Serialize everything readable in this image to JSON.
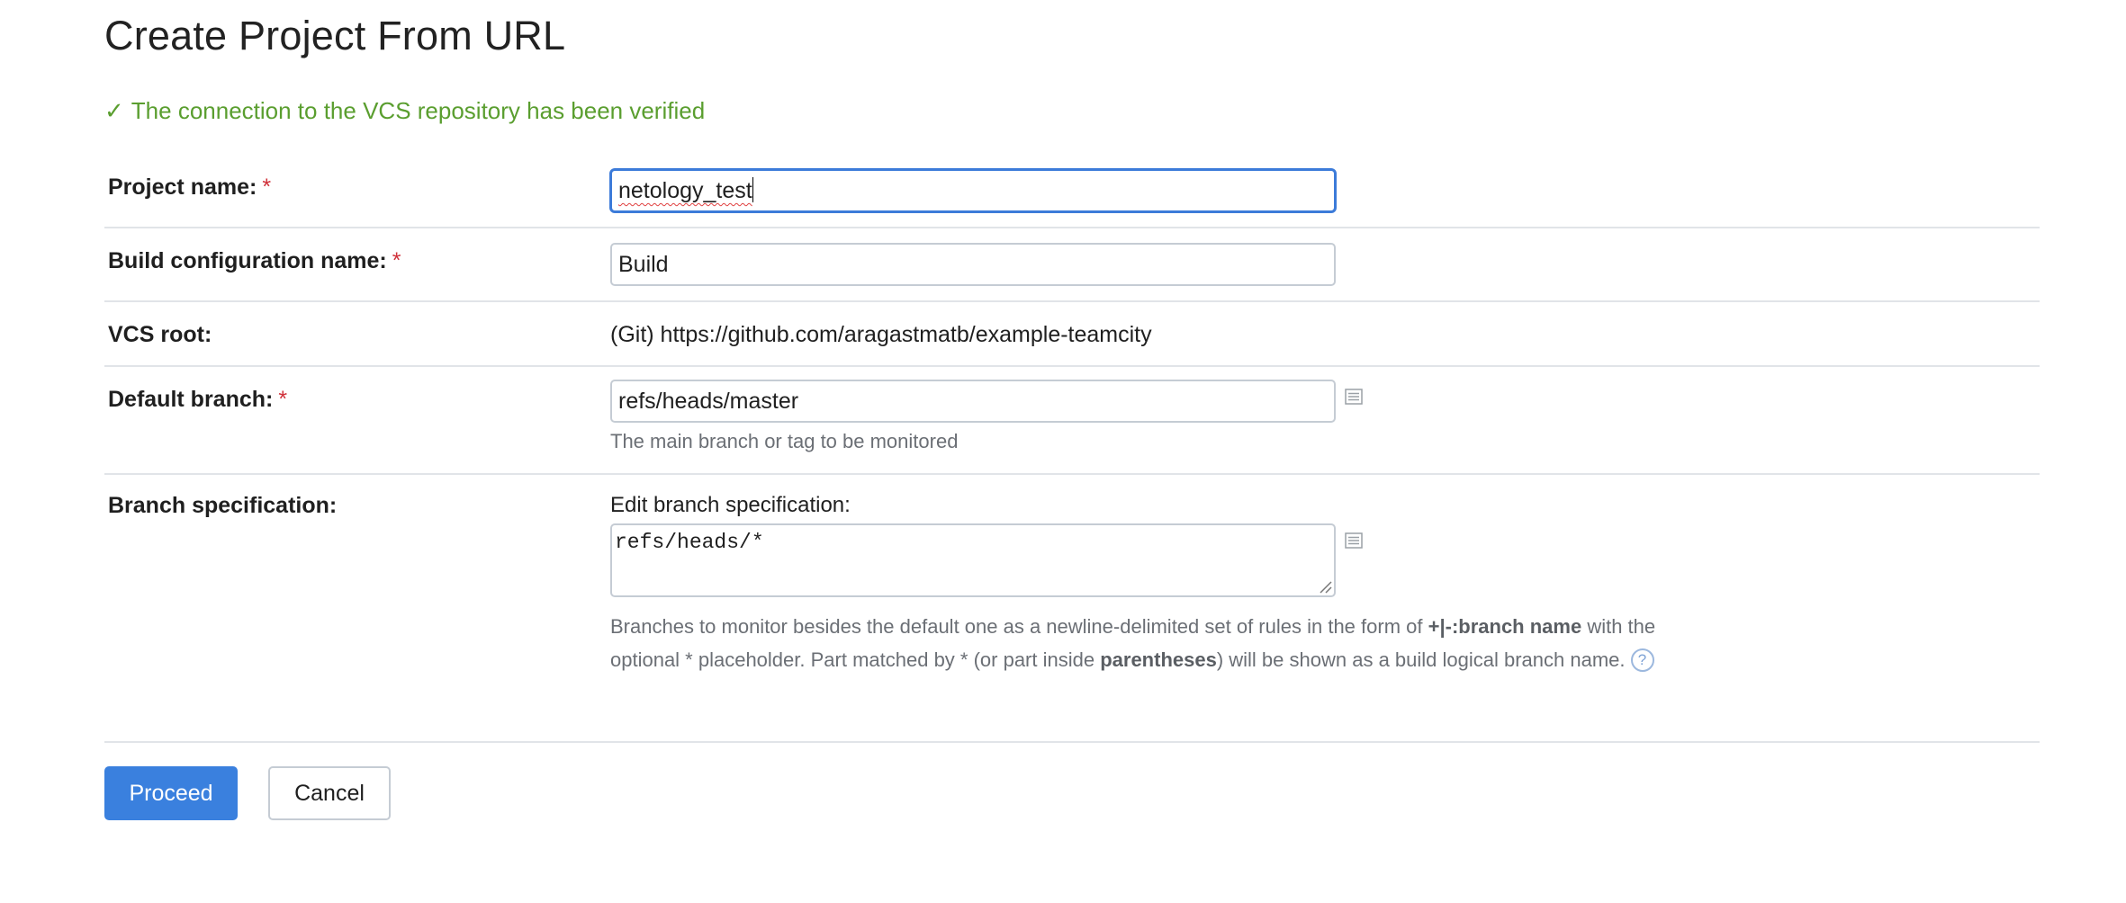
{
  "page": {
    "title": "Create Project From URL",
    "verified_message": "The connection to the VCS repository has been verified",
    "verified_icon": "check-icon"
  },
  "form": {
    "project_name": {
      "label": "Project name:",
      "required_mark": "*",
      "value": "netology_test"
    },
    "build_config_name": {
      "label": "Build configuration name:",
      "required_mark": "*",
      "value": "Build"
    },
    "vcs_root": {
      "label": "VCS root:",
      "value": "(Git) https://github.com/aragastmatb/example-teamcity"
    },
    "default_branch": {
      "label": "Default branch:",
      "required_mark": "*",
      "value": "refs/heads/master",
      "hint": "The main branch or tag to be monitored"
    },
    "branch_spec": {
      "label": "Branch specification:",
      "edit_label": "Edit branch specification:",
      "value": "refs/heads/*",
      "help_part1": "Branches to monitor besides the default one as a newline-delimited set of rules in the form of ",
      "help_bold1": "+|-:branch name",
      "help_part2": " with the",
      "help_part3": "optional * placeholder. Part matched by * (or part inside ",
      "help_bold2": "parentheses",
      "help_part4": ") will be shown as a build logical branch name.",
      "help_icon_glyph": "?"
    }
  },
  "buttons": {
    "proceed": "Proceed",
    "cancel": "Cancel"
  },
  "colors": {
    "success": "#5a9e2f",
    "required": "#d0313a",
    "primary": "#3a80de",
    "focus_border": "#3c7bd9"
  }
}
